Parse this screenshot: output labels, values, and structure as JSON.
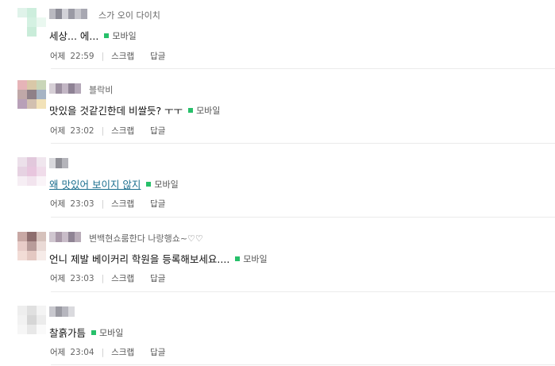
{
  "colors": {
    "mobile_dot": "#27c06a",
    "link": "#1a6e8e"
  },
  "common": {
    "mobile_label": "모바일",
    "scrap_label": "스크랩",
    "reply_label": "답글",
    "date_label": "어제"
  },
  "comments": [
    {
      "subname": "스가 오이 다이치",
      "text": "세상... 에...",
      "time": "22:59"
    },
    {
      "subname": "블락비",
      "text": "맛있을 것같긴한데 비쌀듯? ㅜㅜ",
      "time": "23:02"
    },
    {
      "subname": "",
      "text": "왜 맛있어 보이지 않지",
      "time": "23:03"
    },
    {
      "subname": "변백현쇼룸한다 나랑행쇼~♡♡",
      "text": "언니 제발 베이커리 학원을 등록해보세요....",
      "time": "23:03"
    },
    {
      "subname": "",
      "text": "찰흙가틈",
      "time": "23:04"
    }
  ]
}
